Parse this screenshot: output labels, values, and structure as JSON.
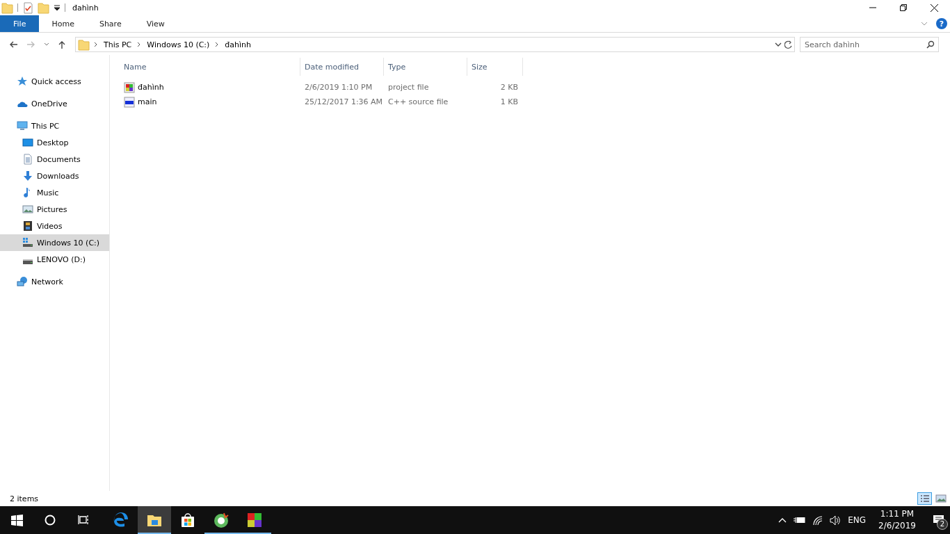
{
  "window": {
    "title": "đahình"
  },
  "ribbon": {
    "tabs": [
      {
        "label": "File",
        "kind": "file",
        "selected": false
      },
      {
        "label": "Home",
        "kind": "plain",
        "selected": false
      },
      {
        "label": "Share",
        "kind": "plain",
        "selected": false
      },
      {
        "label": "View",
        "kind": "plain",
        "selected": false
      }
    ],
    "help": "?"
  },
  "address": {
    "path": [
      "This PC",
      "Windows 10 (C:)",
      "đahình"
    ]
  },
  "search": {
    "placeholder": "Search đahình"
  },
  "sidebar": {
    "items": [
      {
        "label": "Quick access",
        "kind": "star",
        "selected": false
      },
      {
        "label": "OneDrive",
        "kind": "cloud",
        "selected": false
      },
      {
        "label": "This PC",
        "kind": "pc",
        "selected": false,
        "children": [
          {
            "label": "Desktop",
            "kind": "desktop",
            "selected": false
          },
          {
            "label": "Documents",
            "kind": "document",
            "selected": false
          },
          {
            "label": "Downloads",
            "kind": "download",
            "selected": false
          },
          {
            "label": "Music",
            "kind": "music",
            "selected": false
          },
          {
            "label": "Pictures",
            "kind": "picture",
            "selected": false
          },
          {
            "label": "Videos",
            "kind": "video",
            "selected": false
          },
          {
            "label": "Windows 10 (C:)",
            "kind": "sysdrive",
            "selected": true
          },
          {
            "label": "LENOVO (D:)",
            "kind": "drive",
            "selected": false
          }
        ]
      },
      {
        "label": "Network",
        "kind": "network",
        "selected": false
      }
    ]
  },
  "table": {
    "columns": [
      "Name",
      "Date modified",
      "Type",
      "Size"
    ],
    "rows": [
      {
        "name": "đahình",
        "kind": "project",
        "date": "2/6/2019 1:10 PM",
        "type": "project file",
        "size": "2 KB"
      },
      {
        "name": "main",
        "kind": "cpp",
        "date": "25/12/2017 1:36 AM",
        "type": "C++ source file",
        "size": "1 KB"
      }
    ]
  },
  "status_bar": {
    "count": "2 items",
    "views": [
      {
        "kind": "details",
        "selected": true
      },
      {
        "kind": "tiles",
        "selected": false
      }
    ]
  },
  "taskbar": {
    "apps": [
      {
        "kind": "edge",
        "running": false,
        "active": false
      },
      {
        "kind": "explorer",
        "running": true,
        "active": true
      },
      {
        "kind": "store",
        "running": false,
        "active": false
      },
      {
        "kind": "ring",
        "running": true,
        "active": false
      },
      {
        "kind": "blocks",
        "running": true,
        "active": false
      }
    ],
    "language": "ENG",
    "time": "1:11 PM",
    "date": "2/6/2019",
    "notifications": "2"
  }
}
